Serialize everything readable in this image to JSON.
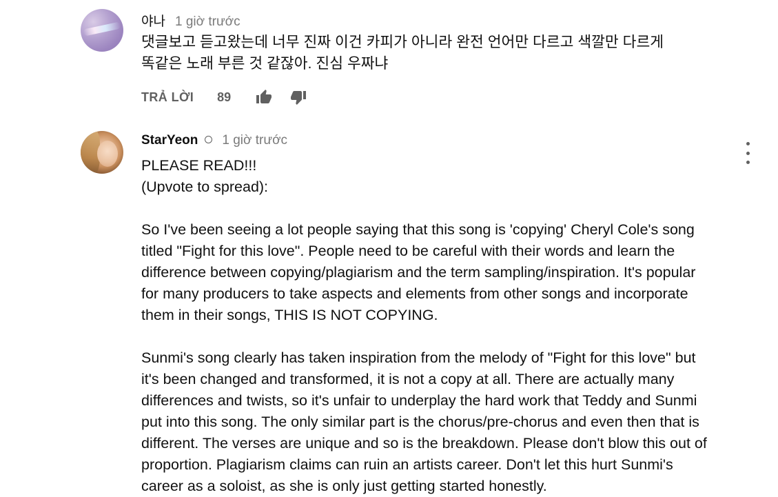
{
  "comments": [
    {
      "author": "야나",
      "timestamp": "1 giờ trước",
      "text": "댓글보고 듣고왔는데 너무 진짜 이건 카피가 아니라 완전 언어만 다르고 색깔만 다르게\n똑같은 노래 부른 것 같잖아. 진심 우짜냐",
      "reply_label": "TRẢ LỜI",
      "like_count": "89"
    },
    {
      "author": "StarYeon",
      "timestamp": "1 giờ trước",
      "text": "PLEASE READ!!!\n(Upvote to spread):\n\nSo I've been seeing a lot people saying that this song is 'copying' Cheryl Cole's song\ntitled \"Fight for this love\". People need to be careful with their words and learn the\ndifference between copying/plagiarism and the term sampling/inspiration. It's popular\nfor many producers to take aspects and elements from other songs and incorporate\nthem in their songs, THIS IS NOT COPYING.\n\nSunmi's song clearly has taken inspiration from the melody of \"Fight for this love\" but\nit's been changed and transformed, it is not a copy at all. There are actually many\ndifferences and twists, so it's unfair to underplay the hard work that Teddy and Sunmi\nput into this song. The only similar part is the chorus/pre-chorus and even then that is\ndifferent. The verses are unique and so is the breakdown. Please don't blow this out of\nproportion. Plagiarism claims can ruin an artists career. Don't let this hurt Sunmi's\ncareer as a soloist, as she is only just getting started honestly."
    }
  ],
  "icons": {
    "like": "thumbs-up-icon",
    "dislike": "thumbs-down-icon",
    "more": "more-vert-icon",
    "verified": "channel-owner-ring-icon"
  },
  "colors": {
    "secondary_text": "#606060",
    "timestamp": "#7a7a7a",
    "primary_text": "#111111"
  }
}
